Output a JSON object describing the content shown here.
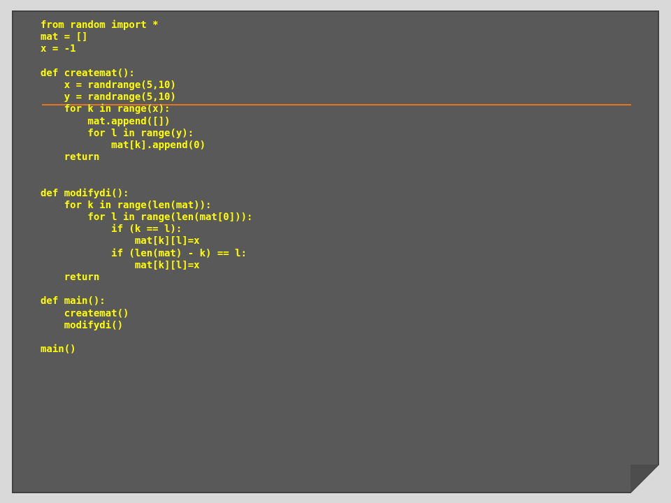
{
  "colors": {
    "page_background": "#d9d9d9",
    "panel_background": "#595959",
    "panel_border": "#404040",
    "code_text": "#ffff00",
    "divider": "#e8751a"
  },
  "code": {
    "lines": [
      "from random import *",
      "mat = []",
      "x = -1",
      "",
      "def createmat():",
      "    x = randrange(5,10)",
      "    y = randrange(5,10)",
      "    for k in range(x):",
      "        mat.append([])",
      "        for l in range(y):",
      "            mat[k].append(0)",
      "    return",
      "",
      "",
      "def modifydi():",
      "    for k in range(len(mat)):",
      "        for l in range(len(mat[0])):",
      "            if (k == l):",
      "                mat[k][l]=x",
      "            if (len(mat) - k) == l:",
      "                mat[k][l]=x",
      "    return",
      "",
      "def main():",
      "    createmat()",
      "    modifydi()",
      "",
      "main()"
    ]
  }
}
